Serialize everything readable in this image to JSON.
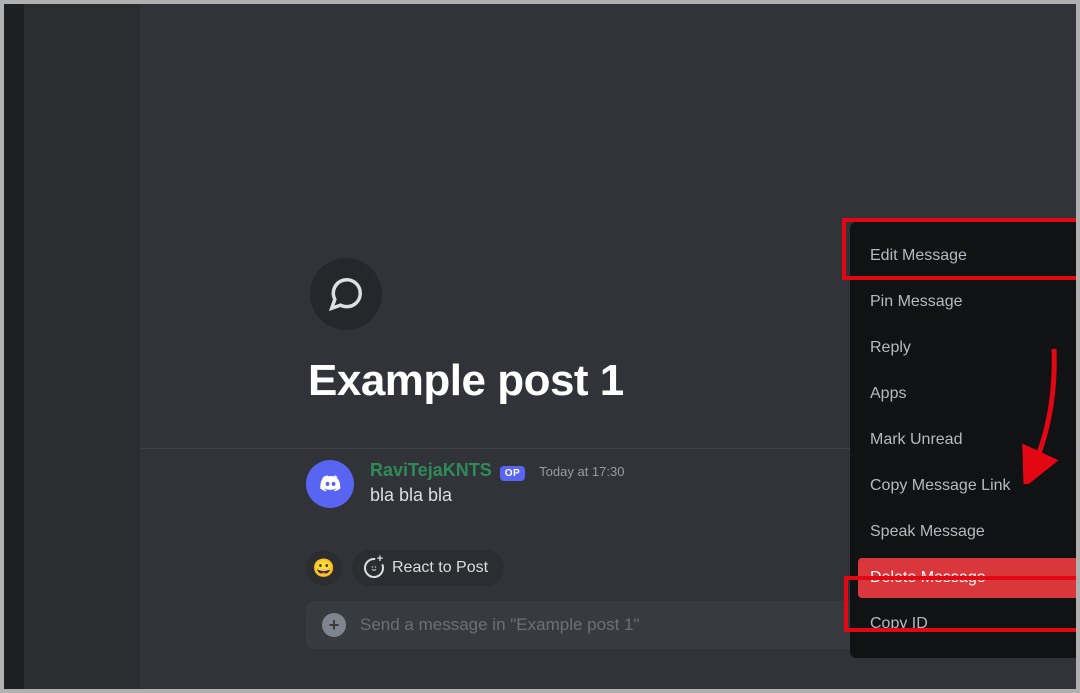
{
  "thread": {
    "title": "Example post 1"
  },
  "message": {
    "author": "RaviTejaKNTS",
    "op_badge": "OP",
    "timestamp": "Today at 17:30",
    "content": "bla bla bla"
  },
  "reactions": {
    "button_label": "React to Post"
  },
  "composer": {
    "placeholder": "Send a message in \"Example post 1\""
  },
  "context_menu": {
    "items": [
      {
        "label": "Edit Message",
        "icon": "pencil-icon",
        "danger": false
      },
      {
        "label": "Pin Message",
        "icon": "pin-icon",
        "danger": false
      },
      {
        "label": "Reply",
        "icon": "reply-icon",
        "danger": false
      },
      {
        "label": "Apps",
        "icon": "chevron-right-icon",
        "danger": false
      },
      {
        "label": "Mark Unread",
        "icon": "unread-icon",
        "danger": false
      },
      {
        "label": "Copy Message Link",
        "icon": "link-icon",
        "danger": false
      },
      {
        "label": "Speak Message",
        "icon": "speaker-icon",
        "danger": false
      },
      {
        "label": "Delete Message",
        "icon": "trash-icon",
        "danger": true
      },
      {
        "label": "Copy ID",
        "icon": "id-icon",
        "danger": false
      }
    ]
  },
  "annotations": {
    "highlight_edit": true,
    "highlight_delete": true,
    "arrow_to_more": true
  }
}
